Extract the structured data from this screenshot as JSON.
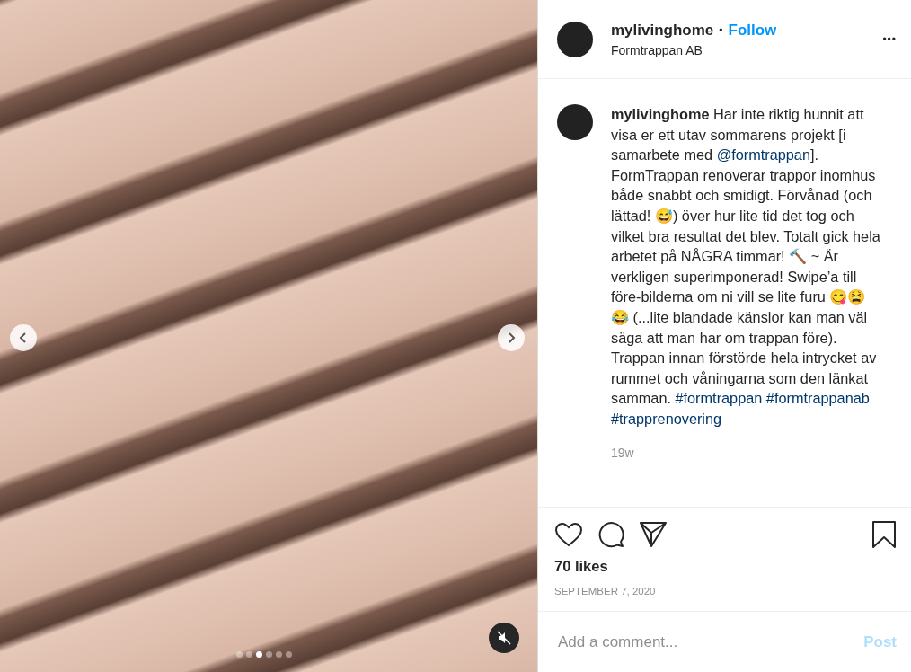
{
  "media": {
    "slides": [
      {
        "selected": false
      },
      {
        "selected": false
      },
      {
        "selected": true
      },
      {
        "selected": false
      },
      {
        "selected": false
      },
      {
        "selected": false
      }
    ],
    "muted": true
  },
  "header": {
    "username": "mylivinghome",
    "separator": "•",
    "follow": "Follow",
    "location": "Formtrappan AB",
    "more": "•••"
  },
  "caption": {
    "username": "mylivinghome",
    "segments": [
      {
        "kind": "text",
        "text": " Har inte riktig hunnit att visa er ett utav sommarens projekt [i samarbete med "
      },
      {
        "kind": "mention",
        "text": "@formtrappan"
      },
      {
        "kind": "text",
        "text": "]. FormTrappan renoverar trappor inomhus både snabbt och smidigt. Förvånad (och lättad! 😅) över hur lite tid det tog och vilket bra resultat det blev. Totalt gick hela arbetet på NÅGRA timmar! 🔨 ~ Är verkligen superimponerad! Swipe’a till före-bilderna om ni vill se lite furu 😋😫😂 (...lite blandade känslor kan man väl säga att man har om trappan före). Trappan innan förstörde hela intrycket av rummet och våningarna som den länkat samman. "
      },
      {
        "kind": "hashtag",
        "text": "#formtrappan"
      },
      {
        "kind": "hashtag",
        "text": "#formtrappanab"
      },
      {
        "kind": "hashtag",
        "text": "#trapprenovering"
      }
    ],
    "age": "19w"
  },
  "likes": "70 likes",
  "date": "SEPTEMBER 7, 2020",
  "comment": {
    "placeholder": "Add a comment...",
    "post": "Post"
  }
}
